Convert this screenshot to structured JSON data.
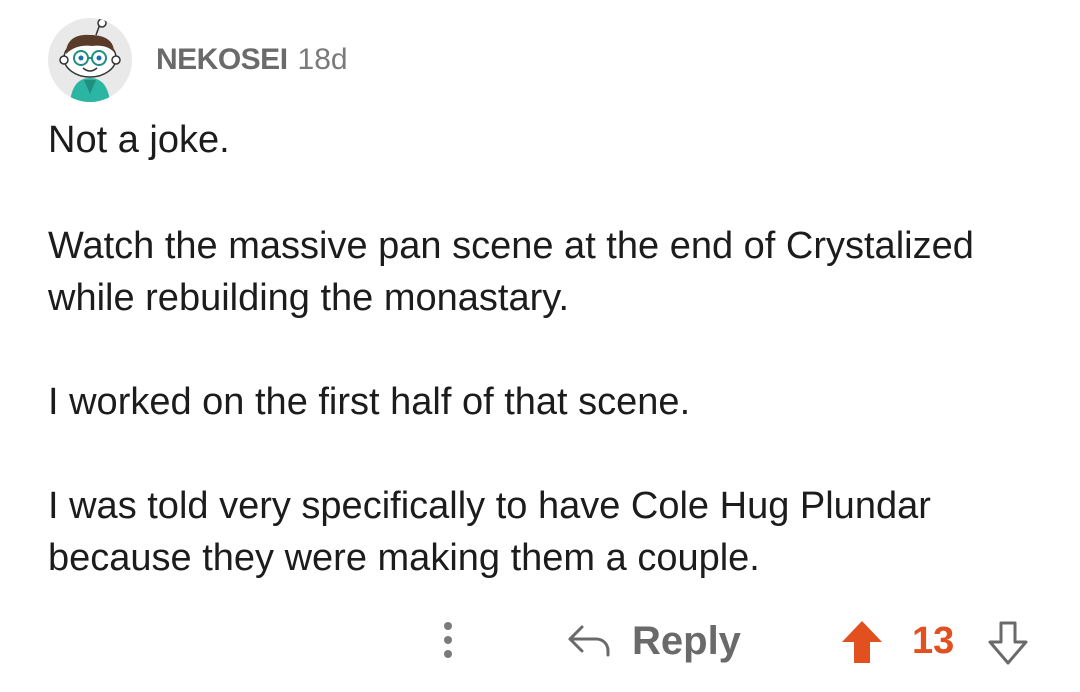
{
  "comment": {
    "author": "NEKOSEI",
    "age": "18d",
    "paragraphs": [
      "Not a joke.",
      "Watch the massive pan scene at the end of Crystalized while rebuilding the monastary.",
      "I worked on the first half of that scene.",
      "I was told very specifically to have Cole Hug Plundar because they were making them a couple."
    ],
    "avatar_icon": "snoo-avatar-icon"
  },
  "actions": {
    "more_icon": "kebab-menu-icon",
    "reply_label": "Reply",
    "reply_icon": "reply-arrow-icon",
    "upvote_icon": "upvote-arrow-icon",
    "score": "13",
    "downvote_icon": "downvote-arrow-icon"
  },
  "colors": {
    "upvote_active": "#e2501f",
    "muted": "#6a6a6a",
    "text": "#1c1c1c"
  }
}
